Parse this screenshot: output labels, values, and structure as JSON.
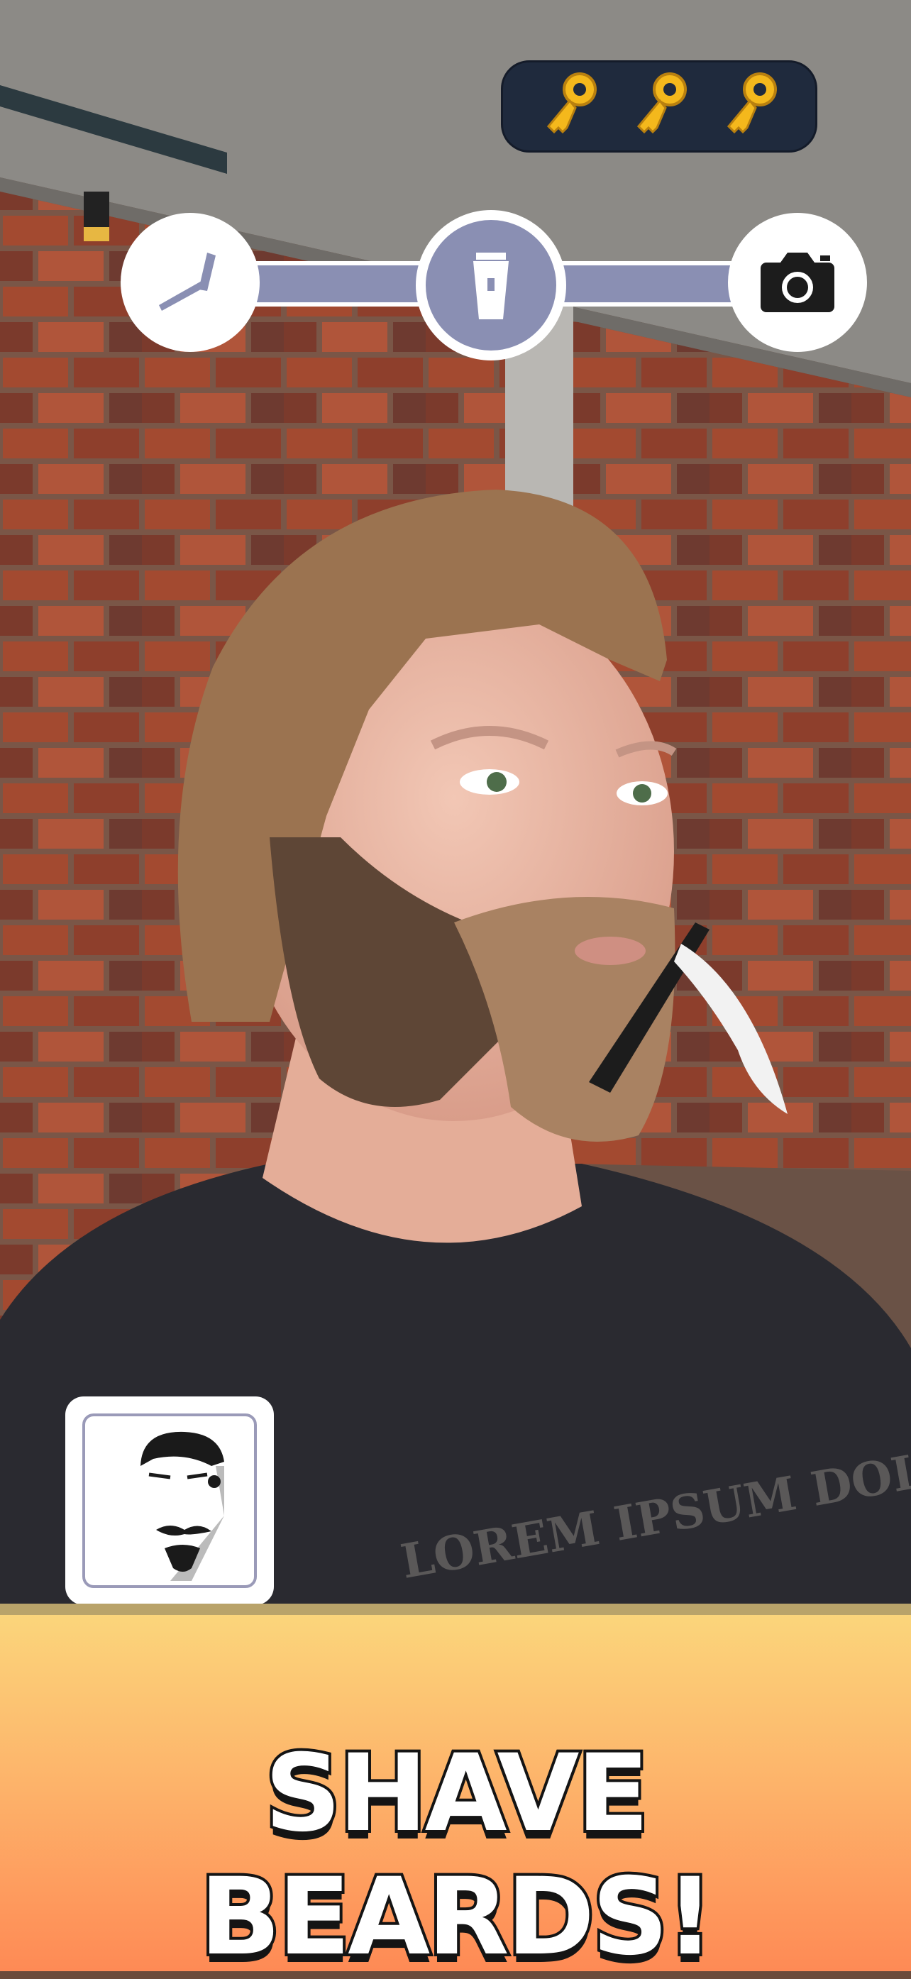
{
  "hud": {
    "keys": [
      "key-icon",
      "key-icon",
      "key-icon"
    ],
    "progress": {
      "steps": [
        "razor-icon",
        "clipper-icon",
        "camera-icon"
      ],
      "current_step": 2,
      "fill_fraction": 1.0
    }
  },
  "scene": {
    "shirt_text": "LOREM IPSUM DOLOR"
  },
  "reference": {
    "icon": "target-style-icon"
  },
  "banner": {
    "title": "SHAVE BEARDS!"
  },
  "colors": {
    "panel_dark": "#1f2a3d",
    "key_gold": "#f4b81c",
    "progress_purple": "#8a8fb3",
    "progress_green": "#69d35a",
    "banner_top": "#fbd57b",
    "banner_bottom": "#fe8a55"
  }
}
